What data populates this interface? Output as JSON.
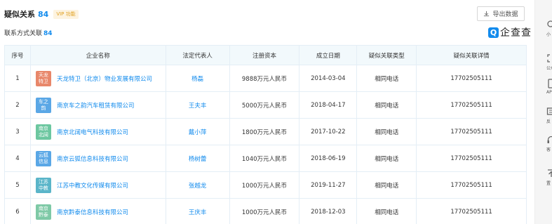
{
  "header": {
    "title": "疑似关系",
    "count": "84",
    "vip_label": "VIP 功能",
    "export_label": "导出数据"
  },
  "sub": {
    "label": "联系方式关联",
    "count": "84"
  },
  "logo": {
    "mark": "Q",
    "text": "企查查"
  },
  "table": {
    "columns": [
      "序号",
      "企业名称",
      "法定代表人",
      "注册资本",
      "成立日期",
      "疑似关联类型",
      "疑似关联详情"
    ],
    "rows": [
      {
        "no": "1",
        "logo": "天龙特卫",
        "logo_color": "#e8876a",
        "name": "天龙特卫（北京）物业发展有限公司",
        "rep": "杨磊",
        "capital": "9888万元人民币",
        "date": "2014-03-04",
        "type": "相同电话",
        "detail": "17702505111"
      },
      {
        "no": "2",
        "logo": "车之韵",
        "logo_color": "#5aa7e6",
        "name": "南京车之韵汽车租赁有限公司",
        "rep": "王夫丰",
        "capital": "5000万元人民币",
        "date": "2018-04-17",
        "type": "相同电话",
        "detail": "17702505111"
      },
      {
        "no": "3",
        "logo": "南京北阔",
        "logo_color": "#6cc7a0",
        "name": "南京北阔电气科技有限公司",
        "rep": "戴小萍",
        "capital": "1800万元人民币",
        "date": "2017-10-22",
        "type": "相同电话",
        "detail": "17702505111"
      },
      {
        "no": "4",
        "logo": "云狐信息",
        "logo_color": "#5aa7e6",
        "name": "南京云狐信息科技有限公司",
        "rep": "杨树蕾",
        "capital": "1040万元人民币",
        "date": "2018-06-19",
        "type": "相同电话",
        "detail": "17702505111"
      },
      {
        "no": "5",
        "logo": "江苏中教",
        "logo_color": "#5ab5c9",
        "name": "江苏中教文化传媒有限公司",
        "rep": "张越龙",
        "capital": "1000万元人民币",
        "date": "2019-11-27",
        "type": "相同电话",
        "detail": "17702505111"
      },
      {
        "no": "6",
        "logo": "南京黔泰",
        "logo_color": "#7ec9a6",
        "name": "南京黔泰信息科技有限公司",
        "rep": "王庆丰",
        "capital": "1000万元人民币",
        "date": "2018-12-03",
        "type": "相同电话",
        "detail": "17702505111"
      }
    ]
  },
  "sidebar": {
    "items": [
      {
        "label": "小",
        "icon": "search-icon"
      },
      {
        "label": "公众",
        "icon": "scan-icon"
      },
      {
        "label": "AP",
        "icon": "phone-icon"
      },
      {
        "label": "反",
        "icon": "feedback-icon"
      },
      {
        "label": "客",
        "icon": "headset-icon"
      },
      {
        "label": "置",
        "icon": "top-icon"
      }
    ]
  }
}
